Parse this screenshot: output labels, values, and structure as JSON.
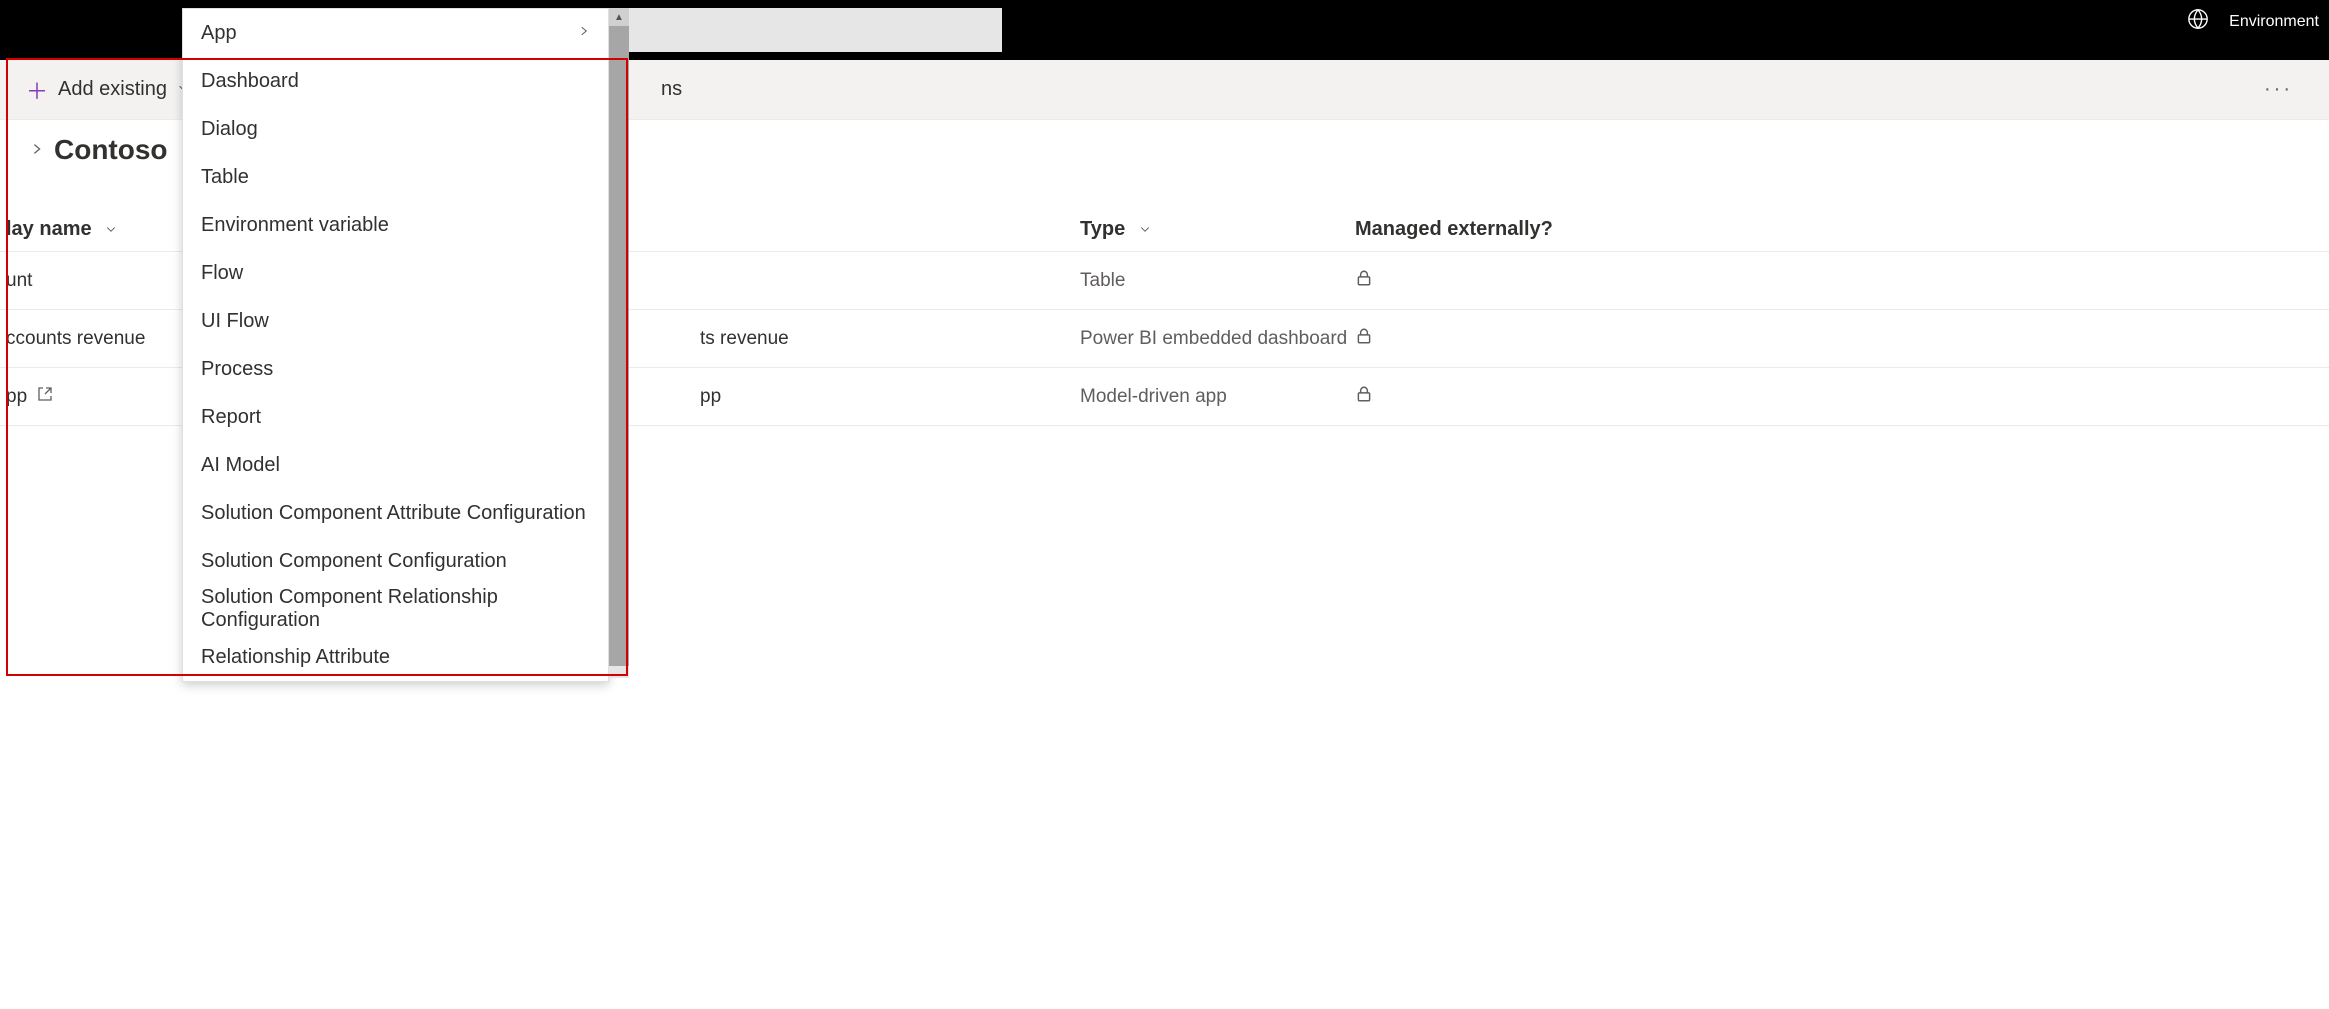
{
  "header": {
    "env_label": "Environment"
  },
  "cmdbar": {
    "add_existing": "Add existing",
    "truncated_tab": "ns"
  },
  "page": {
    "title": "Contoso"
  },
  "columns": {
    "display_name_partial": "lay name",
    "type": "Type",
    "managed_ext": "Managed externally?"
  },
  "rows": [
    {
      "name_left": "unt",
      "name_right": "",
      "type": "Table",
      "locked": true,
      "ext": false
    },
    {
      "name_left": "ccounts revenue",
      "name_right": "ts revenue",
      "type": "Power BI embedded dashboard",
      "locked": true,
      "ext": false
    },
    {
      "name_left": "pp",
      "name_right": "pp",
      "type": "Model-driven app",
      "locked": true,
      "ext": true
    }
  ],
  "menu": {
    "items": [
      {
        "label": "App",
        "has_submenu": true
      },
      {
        "label": "Dashboard",
        "has_submenu": false
      },
      {
        "label": "Dialog",
        "has_submenu": false
      },
      {
        "label": "Table",
        "has_submenu": false
      },
      {
        "label": "Environment variable",
        "has_submenu": false
      },
      {
        "label": "Flow",
        "has_submenu": false
      },
      {
        "label": "UI Flow",
        "has_submenu": false
      },
      {
        "label": "Process",
        "has_submenu": false
      },
      {
        "label": "Report",
        "has_submenu": false
      },
      {
        "label": "AI Model",
        "has_submenu": false
      },
      {
        "label": "Solution Component Attribute Configuration",
        "has_submenu": false
      },
      {
        "label": "Solution Component Configuration",
        "has_submenu": false
      },
      {
        "label": "Solution Component Relationship Configuration",
        "has_submenu": false
      },
      {
        "label": "Relationship Attribute",
        "has_submenu": false
      }
    ]
  }
}
